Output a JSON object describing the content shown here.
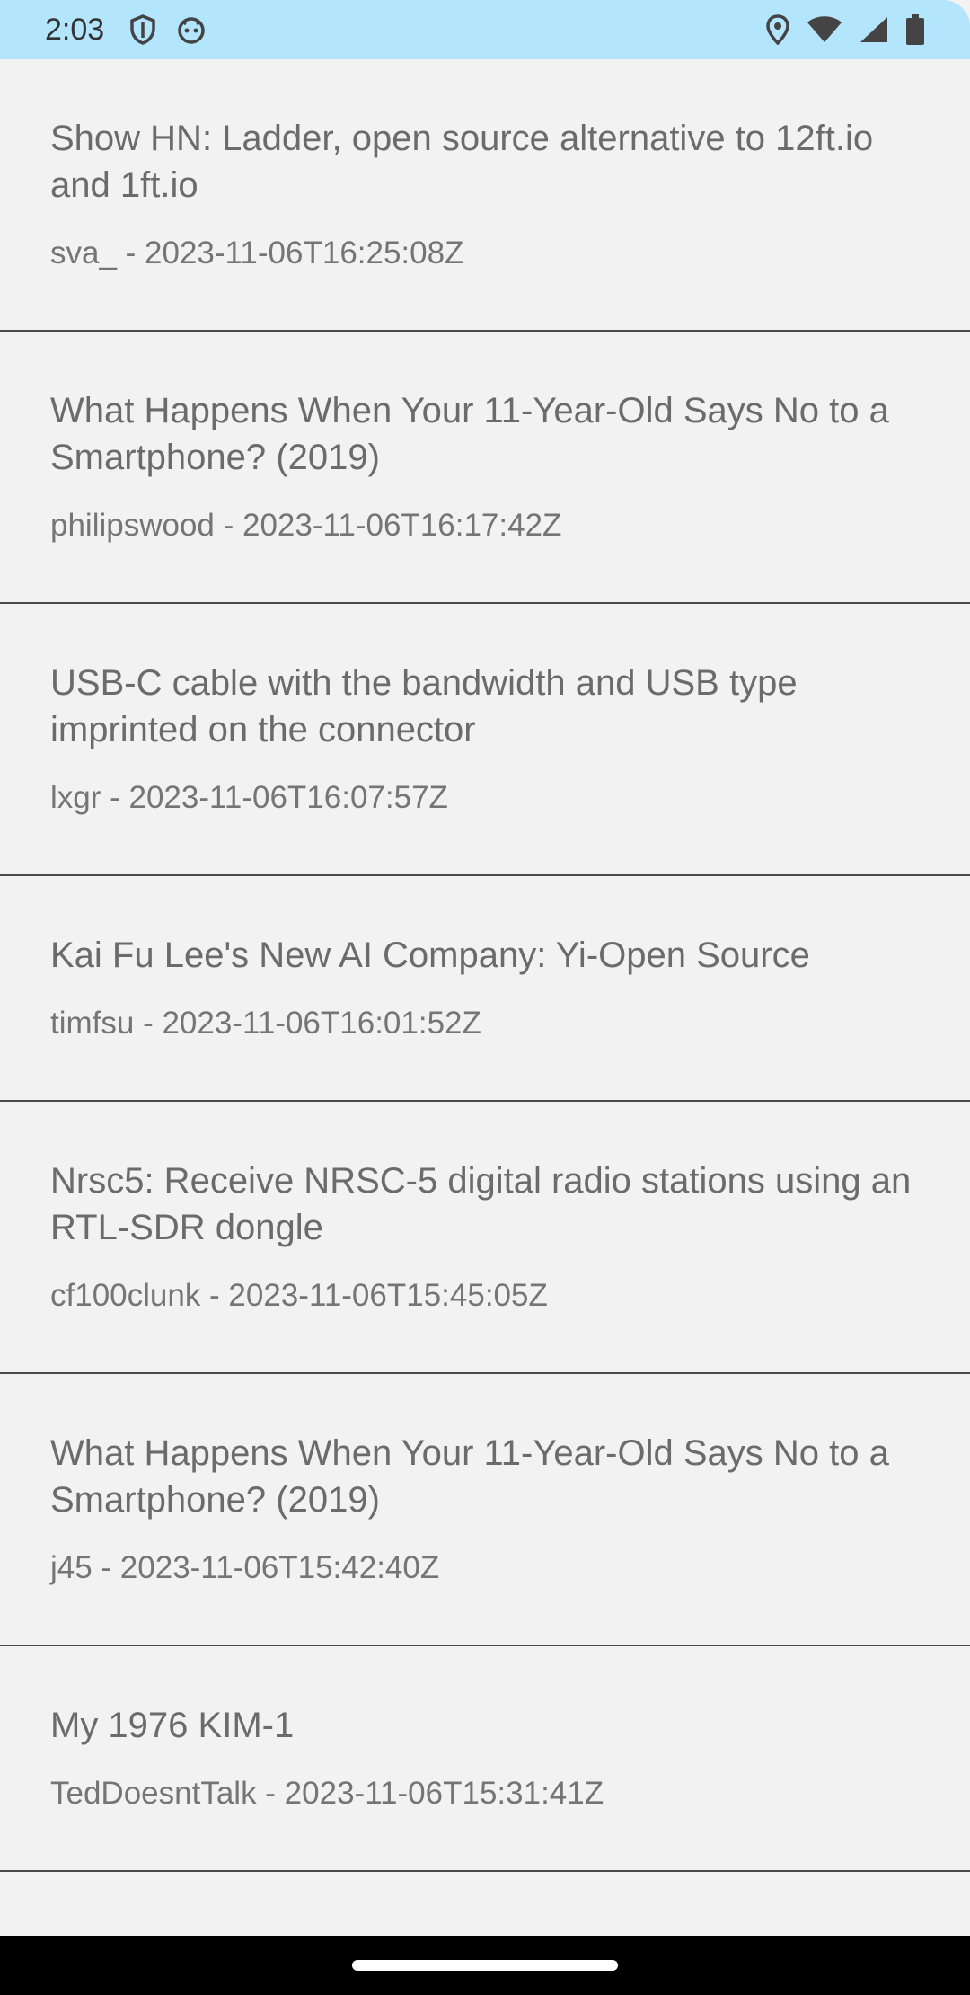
{
  "status_bar": {
    "time": "2:03",
    "left_icons": [
      "shield-icon",
      "android-face-icon"
    ],
    "right_icons": [
      "location-icon",
      "wifi-icon",
      "signal-icon",
      "battery-icon"
    ],
    "background_color": "#b3e5fc"
  },
  "feed": {
    "items": [
      {
        "title": "Show HN: Ladder, open source alternative to 12ft.io and 1ft.io",
        "meta": "sva_ - 2023-11-06T16:25:08Z"
      },
      {
        "title": "What Happens When Your 11-Year-Old Says No to a Smartphone? (2019)",
        "meta": "philipswood - 2023-11-06T16:17:42Z"
      },
      {
        "title": "USB-C cable with the bandwidth and USB type imprinted on the connector",
        "meta": "lxgr - 2023-11-06T16:07:57Z"
      },
      {
        "title": "Kai Fu Lee's New AI Company: Yi-Open Source",
        "meta": "timfsu - 2023-11-06T16:01:52Z"
      },
      {
        "title": "Nrsc5: Receive NRSC-5 digital radio stations using an RTL-SDR dongle",
        "meta": "cf100clunk - 2023-11-06T15:45:05Z"
      },
      {
        "title": "What Happens When Your 11-Year-Old Says No to a Smartphone? (2019)",
        "meta": "j45 - 2023-11-06T15:42:40Z"
      },
      {
        "title": "My 1976 KIM-1",
        "meta": "TedDoesntTalk - 2023-11-06T15:31:41Z"
      }
    ]
  },
  "nav_bar": {
    "background_color": "#000000",
    "indicator_color": "#ffffff"
  }
}
